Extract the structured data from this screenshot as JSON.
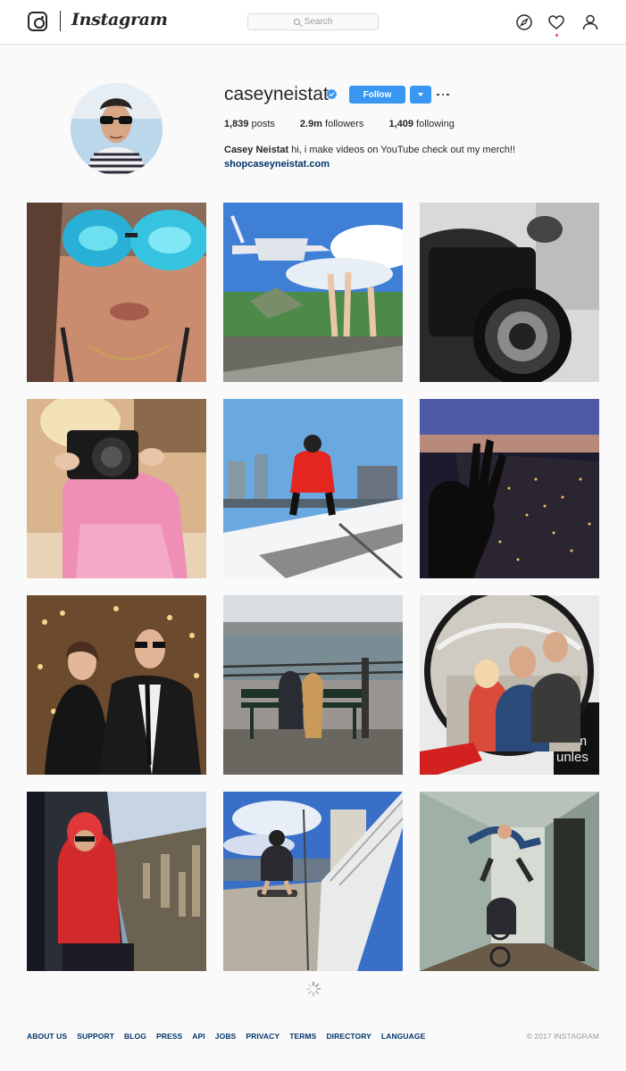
{
  "nav": {
    "wordmark": "Instagram",
    "search_placeholder": "Search",
    "icons": [
      "explore-compass-icon",
      "activity-heart-icon",
      "profile-person-icon"
    ]
  },
  "profile": {
    "username": "caseyneistat",
    "verified": true,
    "follow_label": "Follow",
    "posts_count": "1,839",
    "posts_label": "posts",
    "followers_count": "2.9m",
    "followers_label": "followers",
    "following_count": "1,409",
    "following_label": "following",
    "full_name": "Casey Neistat",
    "bio": "hi, i make videos on YouTube check out my merch!!",
    "website": "shopcaseyneistat.com"
  },
  "posts": [
    {
      "subject": "close-up selfie with blue mirrored sunglasses"
    },
    {
      "subject": "plane flying low over people on a bench by the sea"
    },
    {
      "subject": "black and white camera lens close-up"
    },
    {
      "subject": "child in pink dress holding a camera"
    },
    {
      "subject": "man in red jacket crouching on snowy pier"
    },
    {
      "subject": "hand against window over city at night"
    },
    {
      "subject": "couple in formal wear in front of lights"
    },
    {
      "subject": "people on bench by the river"
    },
    {
      "subject": "family selfie in convex mirror"
    },
    {
      "subject": "man in red jacket in helicopter over city"
    },
    {
      "subject": "skateboarder on waterfront walkway"
    },
    {
      "subject": "people jumping in hallway"
    }
  ],
  "footer": {
    "links": [
      "ABOUT US",
      "SUPPORT",
      "BLOG",
      "PRESS",
      "API",
      "JOBS",
      "PRIVACY",
      "TERMS",
      "DIRECTORY",
      "LANGUAGE"
    ],
    "copyright": "© 2017 INSTAGRAM"
  },
  "colors": {
    "accent": "#3897f0",
    "link": "#003569",
    "background": "#fafafa",
    "border": "#dbdbdb"
  }
}
